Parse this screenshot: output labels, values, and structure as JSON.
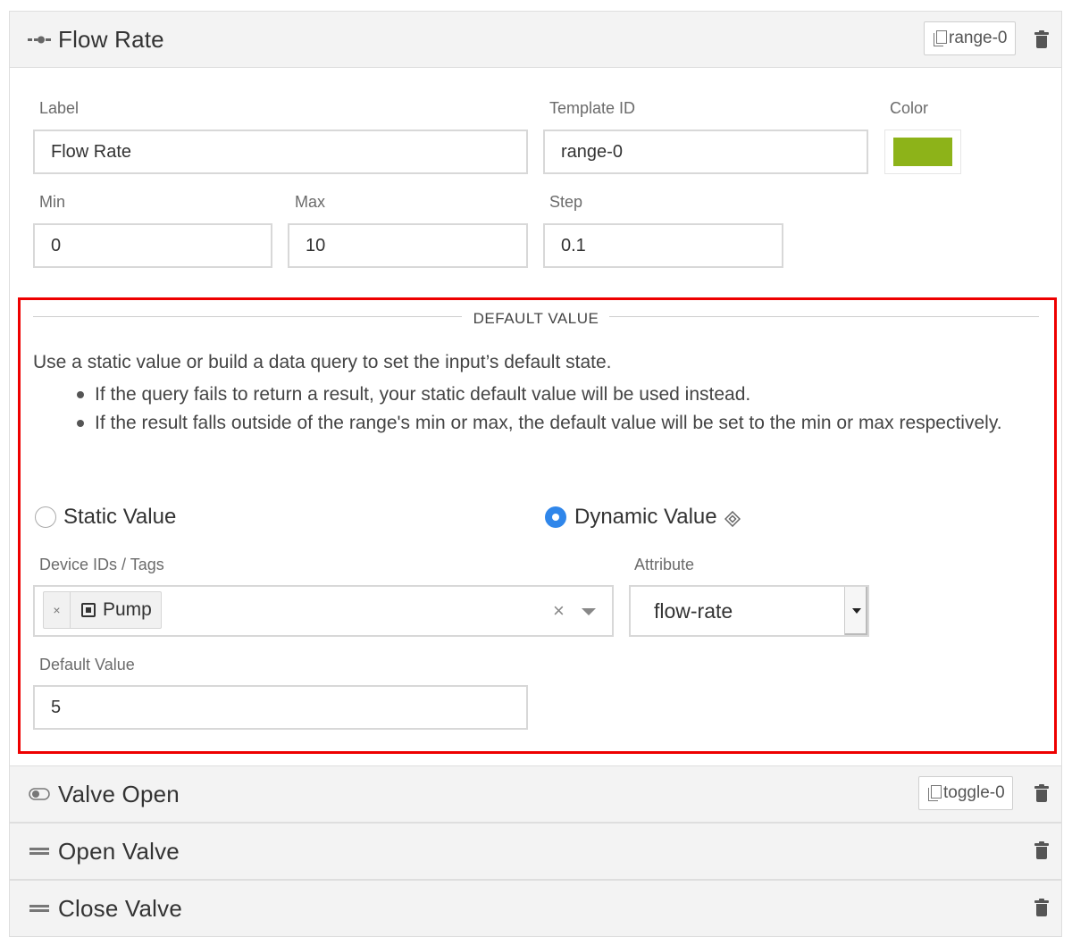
{
  "panels": {
    "flow_rate": {
      "title": "Flow Rate",
      "template_id": "range-0"
    },
    "valve_open": {
      "title": "Valve Open",
      "template_id": "toggle-0"
    },
    "open_valve": {
      "title": "Open Valve"
    },
    "close_valve": {
      "title": "Close Valve"
    }
  },
  "form": {
    "label_caption": "Label",
    "label_value": "Flow Rate",
    "template_id_caption": "Template ID",
    "template_id_value": "range-0",
    "color_caption": "Color",
    "color_value": "#8db319",
    "min_caption": "Min",
    "min_value": "0",
    "max_caption": "Max",
    "max_value": "10",
    "step_caption": "Step",
    "step_value": "0.1"
  },
  "default_value": {
    "section_title": "DEFAULT VALUE",
    "description": "Use a static value or build a data query to set the input’s default state.",
    "bullets": [
      "If the query fails to return a result, your static default value will be used instead.",
      "If the result falls outside of the range's min or max, the default value will be set to the min or max respectively."
    ],
    "static_label": "Static Value",
    "static_selected": false,
    "dynamic_label": "Dynamic Value",
    "dynamic_selected": true,
    "device_ids_caption": "Device IDs / Tags",
    "device_tag": "Pump",
    "tag_remove": "×",
    "clear_symbol": "×",
    "attribute_caption": "Attribute",
    "attribute_value": "flow-rate",
    "default_caption": "Default Value",
    "default_input_value": "5"
  },
  "colors": {
    "highlight": "#ee0000",
    "radio_accent": "#2f86ea",
    "swatch": "#8db319"
  },
  "icons": {
    "flow_rate": "range-slider-icon",
    "valve_open": "toggle-icon",
    "open_valve": "button-icon",
    "close_valve": "button-icon",
    "copy": "copy-icon",
    "delete": "trash-icon",
    "device": "chip-icon",
    "dynamic": "diamond-icon"
  }
}
